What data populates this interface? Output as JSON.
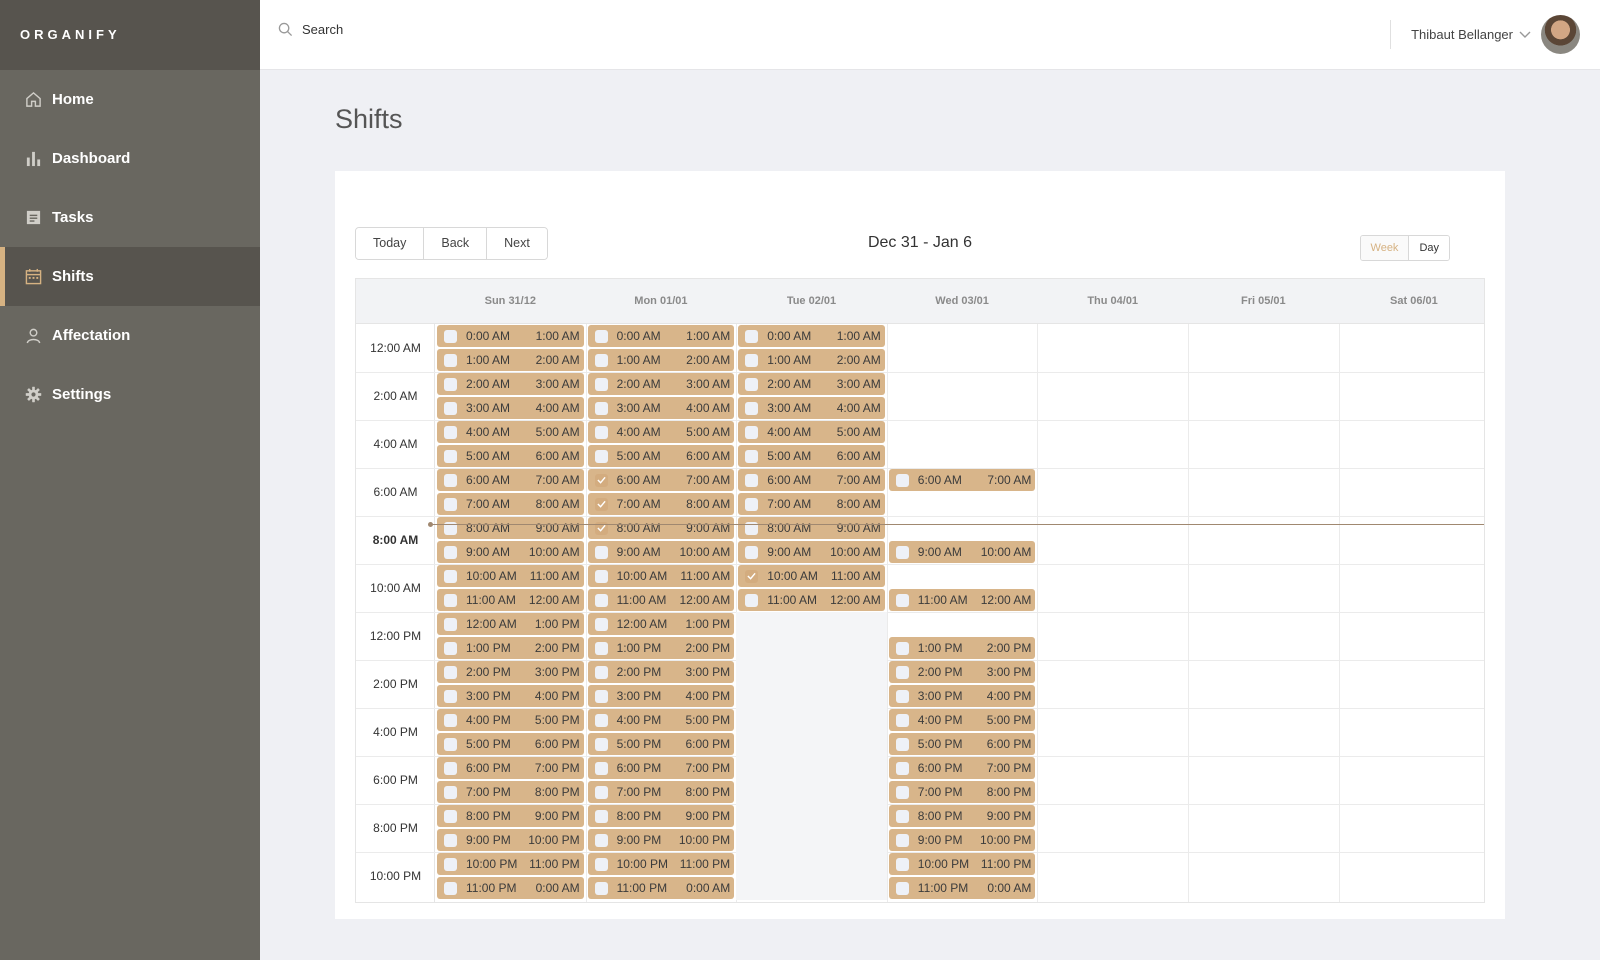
{
  "brand": "ORGANIFY",
  "nav": [
    {
      "label": "Home",
      "icon": "home-icon",
      "active": false
    },
    {
      "label": "Dashboard",
      "icon": "bar-chart-icon",
      "active": false
    },
    {
      "label": "Tasks",
      "icon": "tasks-icon",
      "active": false
    },
    {
      "label": "Shifts",
      "icon": "calendar-icon",
      "active": true
    },
    {
      "label": "Affectation",
      "icon": "user-icon",
      "active": false
    },
    {
      "label": "Settings",
      "icon": "gear-icon",
      "active": false
    }
  ],
  "search": {
    "placeholder": "Search"
  },
  "user": {
    "name": "Thibaut Bellanger"
  },
  "page_title": "Shifts",
  "toolbar": {
    "today": "Today",
    "back": "Back",
    "next": "Next",
    "range": "Dec 31 - Jan 6",
    "week": "Week",
    "day": "Day",
    "active_view": "week"
  },
  "calendar": {
    "days": [
      "Sun 31/12",
      "Mon 01/01",
      "Tue 02/01",
      "Wed 03/01",
      "Thu 04/01",
      "Fri 05/01",
      "Sat 06/01"
    ],
    "time_labels": [
      "12:00 AM",
      "2:00 AM",
      "4:00 AM",
      "6:00 AM",
      "8:00 AM",
      "10:00 AM",
      "12:00 PM",
      "2:00 PM",
      "4:00 PM",
      "6:00 PM",
      "8:00 PM",
      "10:00 PM"
    ],
    "current_time_label": "8:00 AM",
    "hours": [
      "0:00 AM",
      "1:00 AM",
      "2:00 AM",
      "3:00 AM",
      "4:00 AM",
      "5:00 AM",
      "6:00 AM",
      "7:00 AM",
      "8:00 AM",
      "9:00 AM",
      "10:00 AM",
      "11:00 AM",
      "12:00 AM",
      "1:00 PM",
      "2:00 PM",
      "3:00 PM",
      "4:00 PM",
      "5:00 PM",
      "6:00 PM",
      "7:00 PM",
      "8:00 PM",
      "9:00 PM",
      "10:00 PM",
      "11:00 PM"
    ],
    "shifts": [
      {
        "day": 0,
        "hours": [
          0,
          1,
          2,
          3,
          4,
          5,
          6,
          7,
          8,
          9,
          10,
          11,
          12,
          13,
          14,
          15,
          16,
          17,
          18,
          19,
          20,
          21,
          22,
          23
        ],
        "checked": []
      },
      {
        "day": 1,
        "hours": [
          0,
          1,
          2,
          3,
          4,
          5,
          6,
          7,
          8,
          9,
          10,
          11,
          12,
          13,
          14,
          15,
          16,
          17,
          18,
          19,
          20,
          21,
          22,
          23
        ],
        "checked": [
          6,
          7,
          8
        ]
      },
      {
        "day": 2,
        "hours": [
          0,
          1,
          2,
          3,
          4,
          5,
          6,
          7,
          8,
          9,
          10,
          11
        ],
        "checked": [
          10
        ]
      },
      {
        "day": 3,
        "hours": [
          6,
          9,
          11,
          13,
          14,
          15,
          16,
          17,
          18,
          19,
          20,
          21,
          22,
          23
        ],
        "checked": []
      }
    ]
  },
  "colors": {
    "sidebar": "#696760",
    "brand_bar": "#57544e",
    "accent": "#d6b282",
    "shift": "#d8b58a",
    "checkbox": "#eef1f7",
    "checked": "#d3ac7f"
  }
}
